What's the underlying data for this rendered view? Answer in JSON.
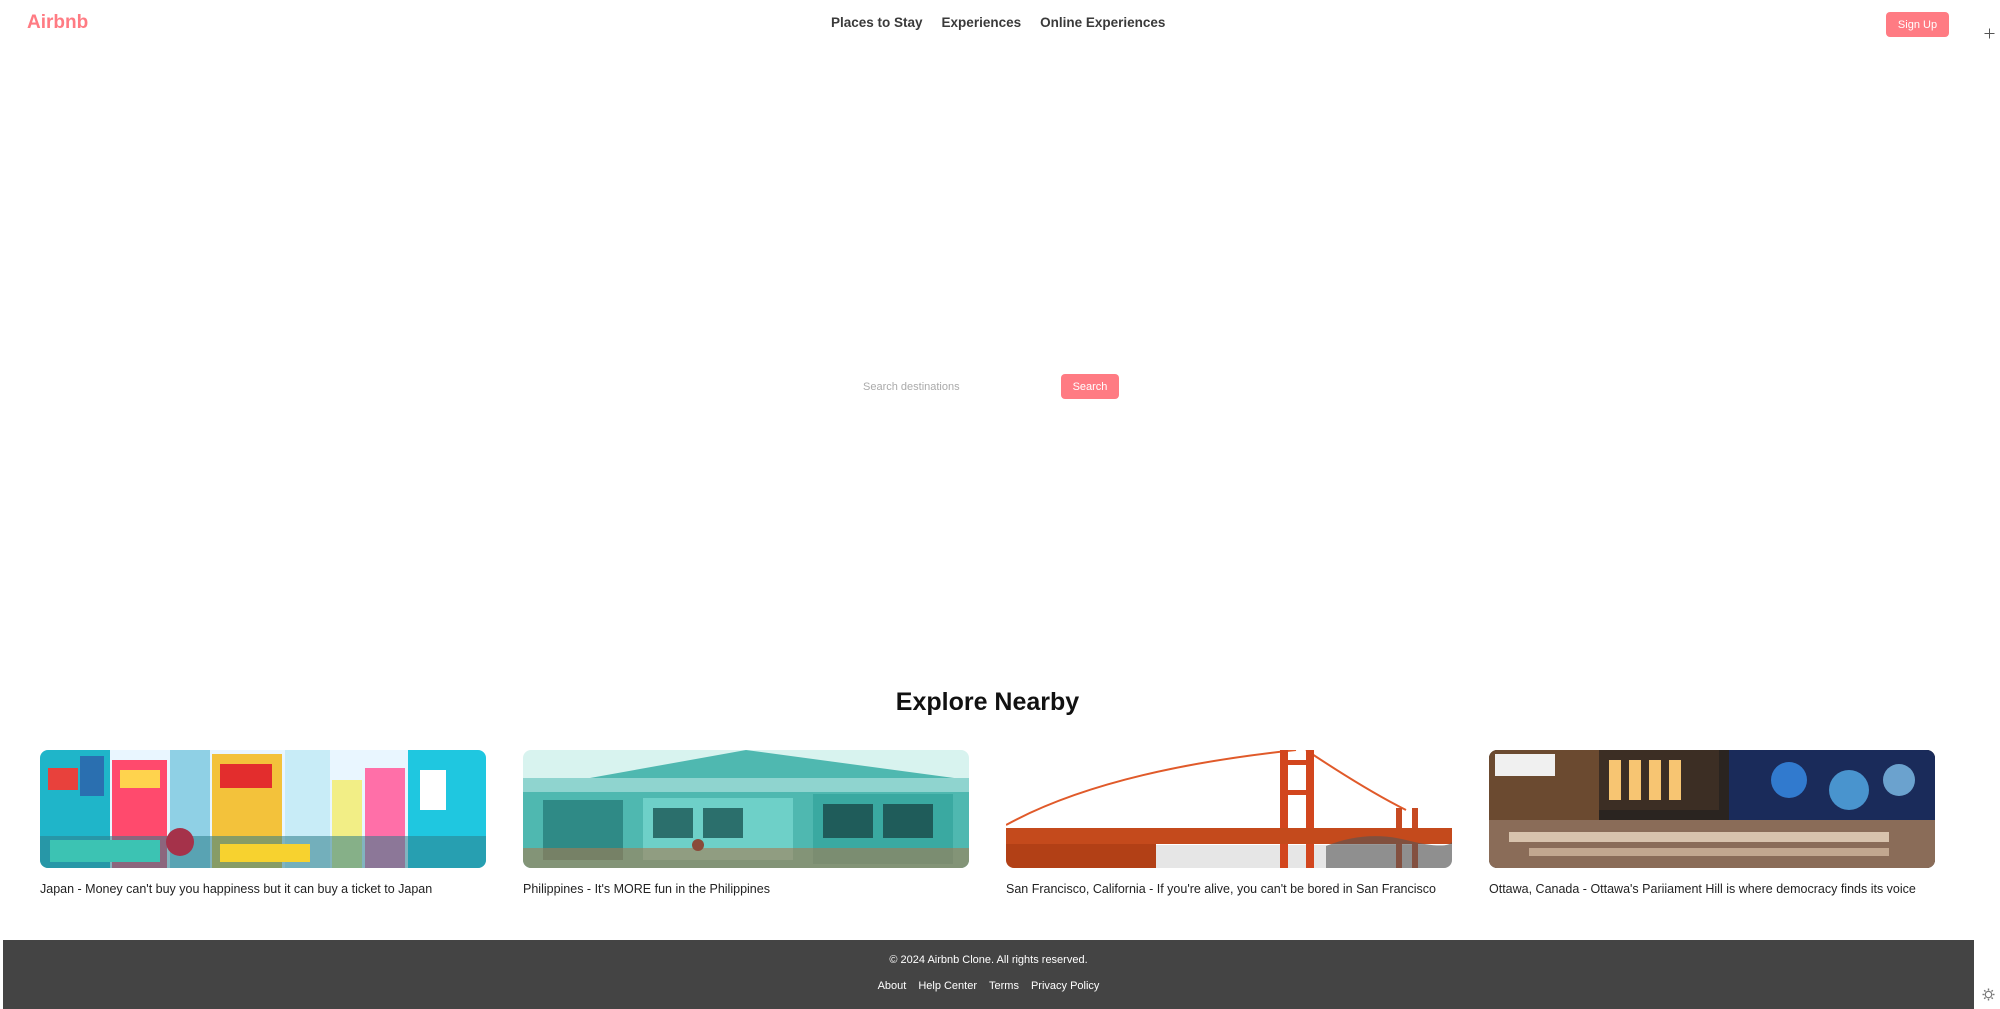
{
  "header": {
    "logo": "Airbnb",
    "nav": [
      "Places to Stay",
      "Experiences",
      "Online Experiences"
    ],
    "signup_label": "Sign Up"
  },
  "search": {
    "placeholder": "Search destinations",
    "button_label": "Search"
  },
  "explore": {
    "title": "Explore Nearby",
    "cards": [
      {
        "caption": "Japan - Money can't buy you happiness but it can buy a ticket to Japan",
        "image": "tokyo-street-scene"
      },
      {
        "caption": "Philippines - It's MORE fun in the Philippines",
        "image": "wooden-house"
      },
      {
        "caption": "San Francisco, California - If you're alive, you can't be bored in San Francisco",
        "image": "golden-gate-bridge"
      },
      {
        "caption": "Ottawa, Canada - Ottawa's Pariiament Hill is where democracy finds its voice",
        "image": "ottawa-night-lights"
      }
    ]
  },
  "footer": {
    "copyright": "© 2024 Airbnb Clone. All rights reserved.",
    "links": [
      "About",
      "Help Center",
      "Terms",
      "Privacy Policy"
    ]
  },
  "icons": {
    "top_right": "plus-icon",
    "bottom_right": "gear-icon"
  },
  "colors": {
    "brand": "#ff7b83",
    "footer_bg": "#444444"
  }
}
